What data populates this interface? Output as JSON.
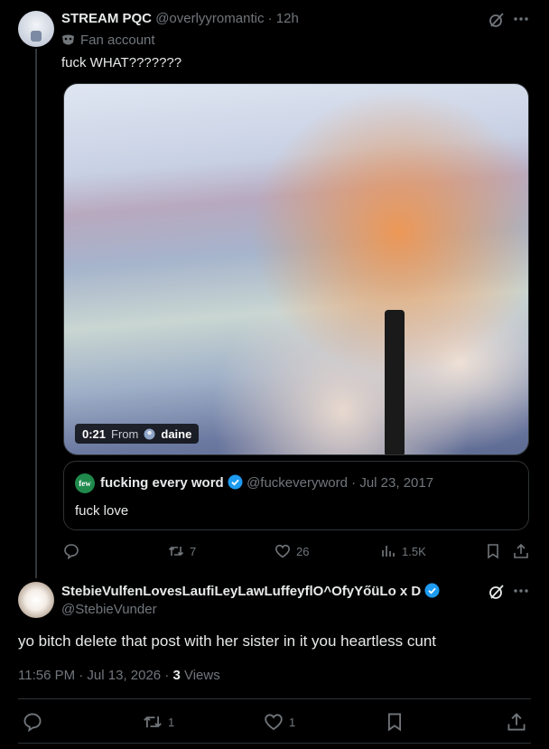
{
  "post1": {
    "display_name": "STREAM PQC",
    "handle": "@overlyyromantic",
    "separator": "·",
    "time": "12h",
    "fan_label": "Fan account",
    "text": "fuck WHAT???????",
    "video": {
      "duration": "0:21",
      "from_label": "From",
      "from_user": "daine"
    },
    "quote": {
      "display_name": "fucking every word",
      "handle": "@fuckeveryword",
      "separator": "·",
      "date": "Jul 23, 2017",
      "text": "fuck love",
      "avatar_text": "few"
    },
    "actions": {
      "reposts": "7",
      "likes": "26",
      "views": "1.5K"
    }
  },
  "post2": {
    "display_name": "StebieVulfenLovesLaufiLeyLawLuffeyflO^OfyYőüLo x D",
    "handle": "@StebieVunder",
    "text": "yo bitch delete that post with her sister in it you heartless cunt",
    "time": "11:56 PM · Jul 13, 2026 · ",
    "views_count": "3",
    "views_label": " Views",
    "actions": {
      "reposts": "1",
      "likes": "1"
    }
  },
  "colors": {
    "background": "#000000",
    "text": "#e7e9ea",
    "muted": "#71767b",
    "verified": "#1d9bf0",
    "border": "#2f3336"
  }
}
